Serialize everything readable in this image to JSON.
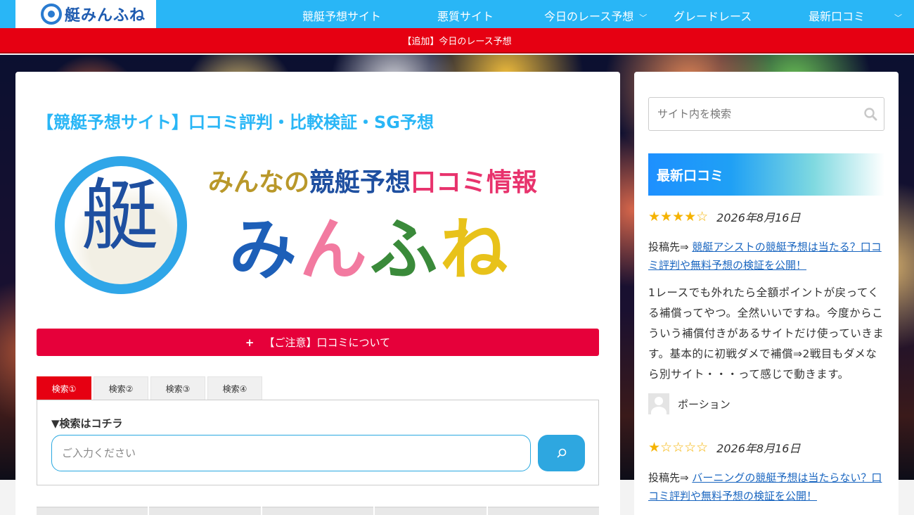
{
  "header": {
    "logo_text": "艇みんふね",
    "nav": [
      {
        "label": "競艇予想サイト",
        "has_dropdown": false
      },
      {
        "label": "悪質サイト",
        "has_dropdown": false
      },
      {
        "label": "今日のレース予想",
        "has_dropdown": true
      },
      {
        "label": "グレードレース",
        "has_dropdown": false
      },
      {
        "label": "最新口コミ",
        "has_dropdown": true
      }
    ]
  },
  "notice_bar": {
    "text": "【追加】今日のレース予想"
  },
  "main": {
    "title": "【競艇予想サイト】口コミ評判・比較検証・SG予想",
    "hero": {
      "kanji": "艇",
      "tagline_a": "みんなの",
      "tagline_b": "競艇予想",
      "tagline_c": "口コミ情報",
      "big_1": "み",
      "big_2": "ん",
      "big_3": "ふ",
      "big_4": "ね"
    },
    "caution_button": {
      "icon": "+",
      "label": "【ご注意】口コミについて"
    },
    "tabs": [
      "検索①",
      "検索②",
      "検索③",
      "検索④"
    ],
    "active_tab": 0,
    "search": {
      "label": "▼検索はコチラ",
      "placeholder": "ご入力ください"
    }
  },
  "sidebar": {
    "search_placeholder": "サイト内を検索",
    "heading": "最新口コミ",
    "reviews": [
      {
        "stars": "★★★★☆",
        "rating": 4,
        "date": "2026年8月16日",
        "post_prefix": "投稿先⇒ ",
        "post_link": "競艇アシストの競艇予想は当たる？口コミ評判や無料予想の検証を公開！",
        "body": "1レースでも外れたら全額ポイントが戻ってくる補償ってやつ。全然いいですね。今度からこういう補償付きがあるサイトだけ使っていきます。基本的に初戦ダメで補償⇒2戦目もダメなら別サイト・・・って感じで動きます。",
        "author": "ポーション"
      },
      {
        "stars": "★☆☆☆☆",
        "rating": 1,
        "date": "2026年8月16日",
        "post_prefix": "投稿先⇒ ",
        "post_link": "バーニングの競艇予想は当たらない？口コミ評判や無料予想の検証を公開！"
      }
    ]
  },
  "colors": {
    "header_bg": "#29b6f6",
    "notice_bg": "#e60012",
    "title": "#29b6f6",
    "caution_bg": "#e6003a",
    "star": "#f5b301",
    "link": "#1a66c0"
  }
}
